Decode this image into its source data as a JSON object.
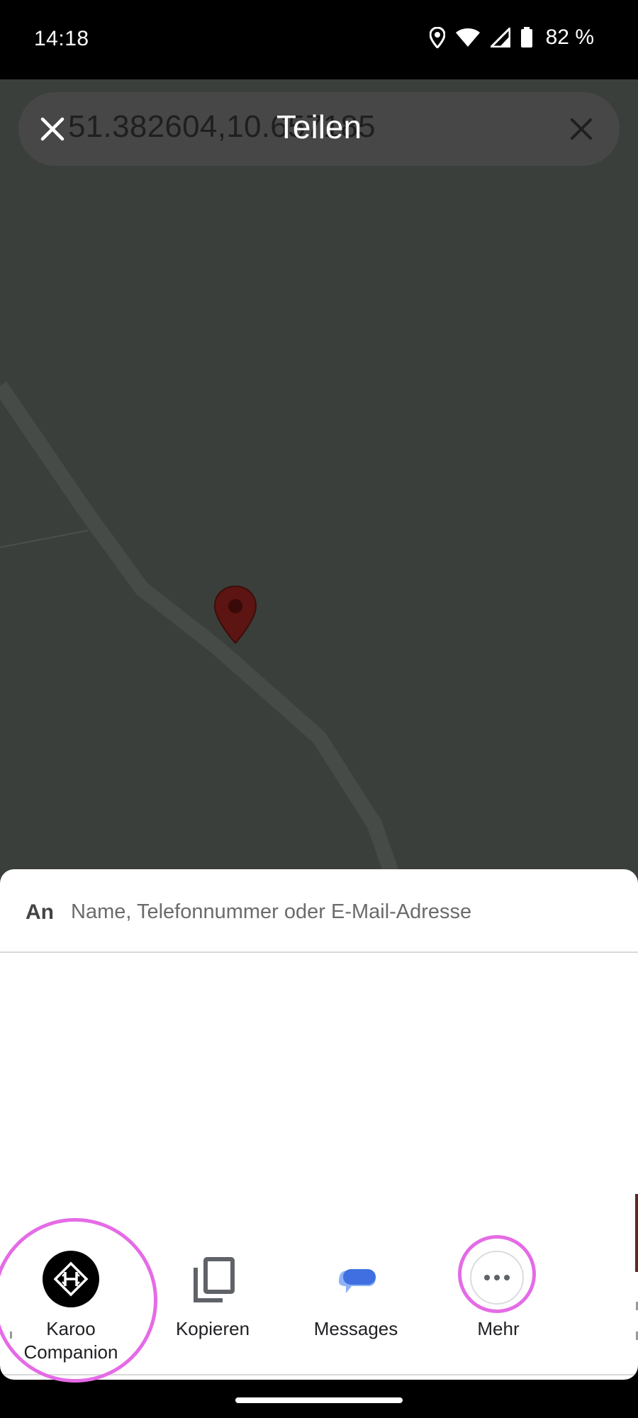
{
  "status_bar": {
    "time": "14:18",
    "battery": "82 %",
    "icons": [
      "location-icon",
      "wifi-icon",
      "signal-icon",
      "battery-icon"
    ]
  },
  "search": {
    "coordinates": "51.382604,10.657185",
    "title": "Teilen"
  },
  "share_sheet": {
    "to_label": "An",
    "to_placeholder": "Name, Telefonnummer oder E-Mail-Adresse",
    "targets": [
      {
        "label": "Karoo\nCompanion",
        "icon": "karoo-icon"
      },
      {
        "label": "Kopieren",
        "icon": "copy-icon"
      },
      {
        "label": "Messages",
        "icon": "messages-icon"
      },
      {
        "label": "Mehr",
        "icon": "more-icon"
      }
    ]
  },
  "colors": {
    "map_background": "#3a3f3b",
    "road": "#464b48",
    "pin": "#5c1512",
    "highlight": "#e56be6",
    "messages_blue": "#3f6fe0"
  }
}
